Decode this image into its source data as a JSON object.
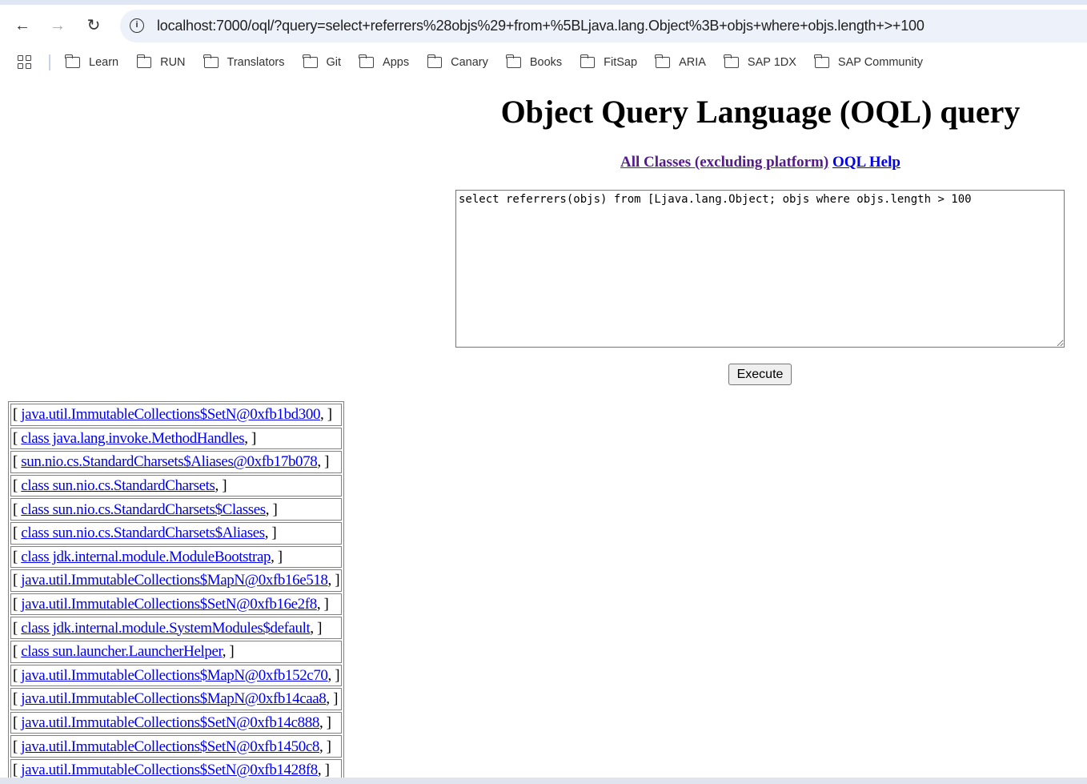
{
  "browser": {
    "url": "localhost:7000/oql/?query=select+referrers%28objs%29+from+%5BLjava.lang.Object%3B+objs+where+objs.length+>+100",
    "bookmarks": [
      "Learn",
      "RUN",
      "Translators",
      "Git",
      "Apps",
      "Canary",
      "Books",
      "FitSap",
      "ARIA",
      "SAP 1DX",
      "SAP Community"
    ]
  },
  "page": {
    "title": "Object Query Language (OQL) query",
    "link_all_classes": "All Classes (excluding platform)",
    "link_oql_help": "OQL Help",
    "query": "select referrers(objs) from [Ljava.lang.Object; objs where objs.length > 100",
    "execute_label": "Execute"
  },
  "results": [
    "java.util.ImmutableCollections$SetN@0xfb1bd300",
    "class java.lang.invoke.MethodHandles",
    "sun.nio.cs.StandardCharsets$Aliases@0xfb17b078",
    "class sun.nio.cs.StandardCharsets",
    "class sun.nio.cs.StandardCharsets$Classes",
    "class sun.nio.cs.StandardCharsets$Aliases",
    "class jdk.internal.module.ModuleBootstrap",
    "java.util.ImmutableCollections$MapN@0xfb16e518",
    "java.util.ImmutableCollections$SetN@0xfb16e2f8",
    "class jdk.internal.module.SystemModules$default",
    "class sun.launcher.LauncherHelper",
    "java.util.ImmutableCollections$MapN@0xfb152c70",
    "java.util.ImmutableCollections$MapN@0xfb14caa8",
    "java.util.ImmutableCollections$SetN@0xfb14c888",
    "java.util.ImmutableCollections$SetN@0xfb1450c8",
    "java.util.ImmutableCollections$SetN@0xfb1428f8"
  ],
  "row_prefix": "[ ",
  "row_suffix": ", ]"
}
